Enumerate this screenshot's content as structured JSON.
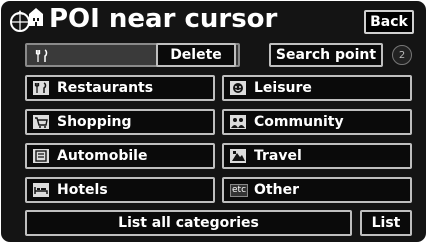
{
  "header": {
    "title": "POI near cursor",
    "back_label": "Back"
  },
  "search": {
    "field_value": "",
    "delete_label": "Delete",
    "search_point_label": "Search point",
    "badge": "2"
  },
  "categories": [
    {
      "label": "Restaurants",
      "icon": "fork-knife-icon"
    },
    {
      "label": "Leisure",
      "icon": "leisure-icon"
    },
    {
      "label": "Shopping",
      "icon": "shopping-cart-icon"
    },
    {
      "label": "Community",
      "icon": "community-icon"
    },
    {
      "label": "Automobile",
      "icon": "automobile-icon"
    },
    {
      "label": "Travel",
      "icon": "travel-icon"
    },
    {
      "label": "Hotels",
      "icon": "hotel-bed-icon"
    },
    {
      "label": "Other",
      "icon": "etc-icon",
      "icon_text": "etc"
    }
  ],
  "footer": {
    "list_all_label": "List all categories",
    "list_label": "List"
  },
  "colors": {
    "background": "#141414",
    "button_border": "#bfbfbf",
    "text": "#ffffff"
  }
}
